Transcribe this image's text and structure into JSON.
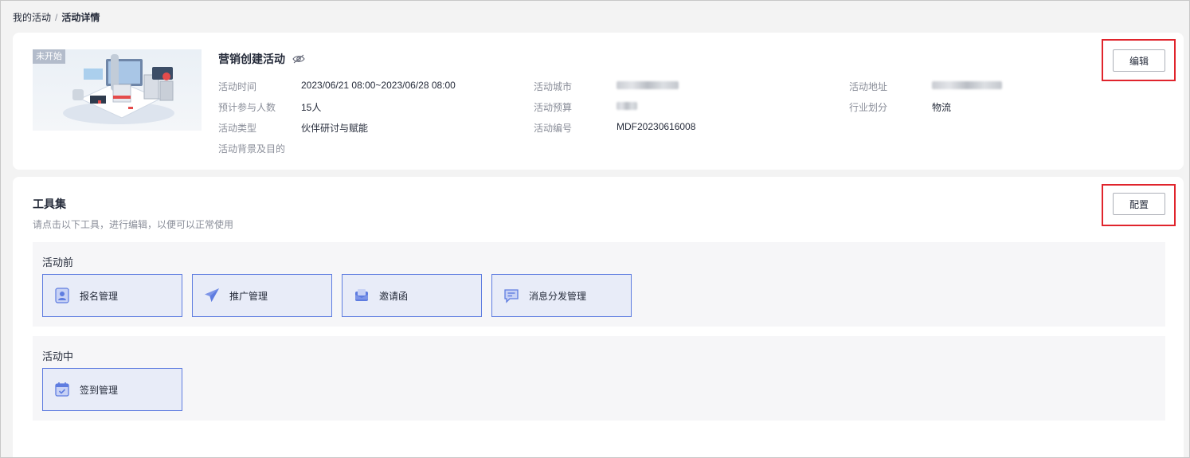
{
  "breadcrumb": {
    "parent": "我的活动",
    "separator": "/",
    "current": "活动详情"
  },
  "activity": {
    "status": "未开始",
    "title": "营销创建活动",
    "fields": {
      "time": {
        "label": "活动时间",
        "value": "2023/06/21 08:00~2023/06/28 08:00"
      },
      "attendees": {
        "label": "预计参与人数",
        "value": "15人"
      },
      "type": {
        "label": "活动类型",
        "value": "伙伴研讨与赋能"
      },
      "background": {
        "label": "活动背景及目的",
        "value": ""
      },
      "city": {
        "label": "活动城市",
        "value": ""
      },
      "budget": {
        "label": "活动预算",
        "value": ""
      },
      "code": {
        "label": "活动编号",
        "value": "MDF20230616008"
      },
      "address": {
        "label": "活动地址",
        "value": ""
      },
      "industry": {
        "label": "行业划分",
        "value": "物流"
      }
    },
    "edit_label": "编辑"
  },
  "tools": {
    "title": "工具集",
    "subtitle": "请点击以下工具，进行编辑，以便可以正常使用",
    "config_label": "配置",
    "phases": [
      {
        "title": "活动前",
        "items": [
          {
            "label": "报名管理",
            "icon": "contact-card-icon"
          },
          {
            "label": "推广管理",
            "icon": "paper-plane-icon"
          },
          {
            "label": "邀请函",
            "icon": "invitation-envelope-icon"
          },
          {
            "label": "消息分发管理",
            "icon": "message-icon"
          }
        ]
      },
      {
        "title": "活动中",
        "items": [
          {
            "label": "签到管理",
            "icon": "calendar-check-icon"
          }
        ]
      }
    ]
  },
  "colors": {
    "accent": "#5e7ce0",
    "tile_bg": "#e8ecf8",
    "highlight": "#e0242c",
    "muted_text": "#8a8e99"
  }
}
